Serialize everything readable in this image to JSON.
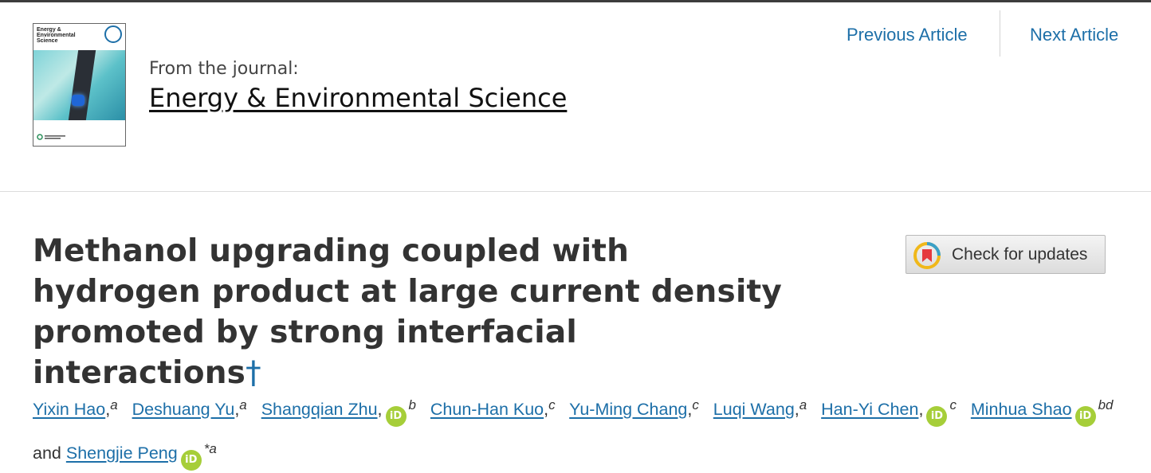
{
  "header": {
    "cover": {
      "title": "Energy & Environmental Science",
      "accent_color": "#1d6fa8"
    },
    "from_label": "From the journal:",
    "journal_name": "Energy & Environmental Science",
    "nav": {
      "previous": "Previous Article",
      "next": "Next Article"
    }
  },
  "article": {
    "title": "Methanol upgrading coupled with hydrogen product at large current density promoted by strong interfacial interactions",
    "footnote_mark": "†"
  },
  "check_updates": {
    "label": "Check for updates",
    "icon": "crossmark-icon"
  },
  "authors": [
    {
      "name": "Yixin Hao",
      "orcid": false,
      "aff": "a"
    },
    {
      "name": "Deshuang Yu",
      "orcid": false,
      "aff": "a"
    },
    {
      "name": "Shangqian Zhu",
      "orcid": true,
      "aff": "b"
    },
    {
      "name": "Chun-Han Kuo",
      "orcid": false,
      "aff": "c"
    },
    {
      "name": "Yu-Ming Chang",
      "orcid": false,
      "aff": "c"
    },
    {
      "name": "Luqi Wang",
      "orcid": false,
      "aff": "a"
    },
    {
      "name": "Han-Yi Chen",
      "orcid": true,
      "aff": "c"
    },
    {
      "name": "Minhua Shao",
      "orcid": true,
      "aff": "bd"
    },
    {
      "name": "Shengjie Peng",
      "orcid": true,
      "aff": "*a"
    }
  ],
  "authors_conjunction": "and",
  "orcid_icon_text": "iD",
  "colors": {
    "link": "#1d6fa8",
    "orcid": "#a6ce39"
  }
}
